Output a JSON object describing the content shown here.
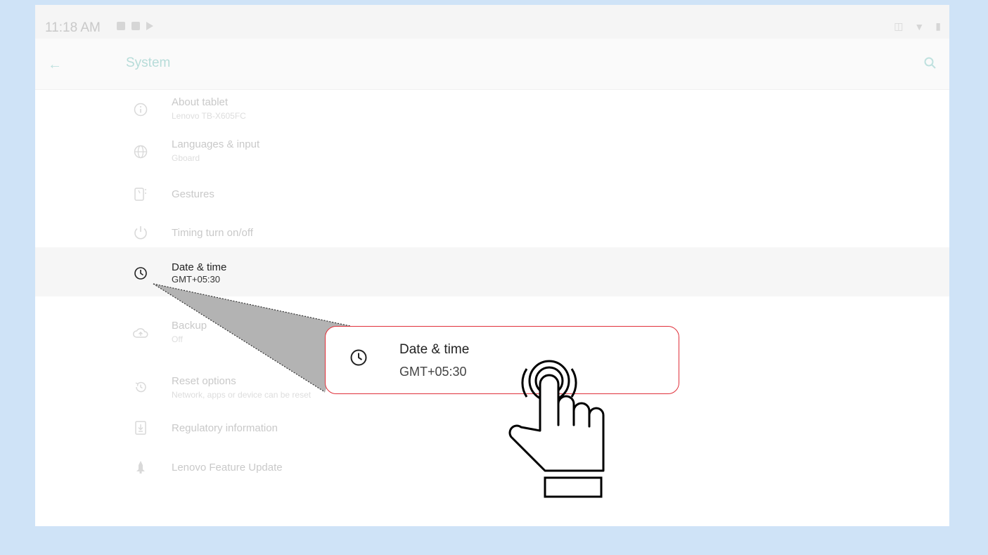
{
  "status_bar": {
    "time": "11:18 AM",
    "left_icons": [
      "image-icon",
      "sd-card-icon",
      "play-store-icon"
    ],
    "right_icons": [
      "vibrate-icon",
      "wifi-icon",
      "battery-icon"
    ]
  },
  "toolbar": {
    "back_icon": "arrow-left-icon",
    "title": "System",
    "search_icon": "search-icon"
  },
  "settings": [
    {
      "icon": "info-icon",
      "title": "About tablet",
      "subtitle": "Lenovo TB-X605FC"
    },
    {
      "icon": "globe-icon",
      "title": "Languages & input",
      "subtitle": "Gboard"
    },
    {
      "icon": "gestures-icon",
      "title": "Gestures",
      "subtitle": ""
    },
    {
      "icon": "power-icon",
      "title": "Timing turn on/off",
      "subtitle": ""
    },
    {
      "icon": "clock-icon",
      "title": "Date & time",
      "subtitle": "GMT+05:30"
    },
    {
      "icon": "backup-icon",
      "title": "Backup",
      "subtitle": "Off"
    },
    {
      "icon": "reset-icon",
      "title": "Reset options",
      "subtitle": "Network, apps or device can be reset"
    },
    {
      "icon": "regulatory-icon",
      "title": "Regulatory information",
      "subtitle": ""
    },
    {
      "icon": "update-icon",
      "title": "Lenovo Feature Update",
      "subtitle": ""
    }
  ],
  "callout": {
    "title": "Date & time",
    "subtitle": "GMT+05:30",
    "border_color": "#e0303a"
  },
  "colors": {
    "page_background": "#cfe3f7",
    "accent_teal": "#b7dcd9",
    "highlight_row": "#f6f6f6"
  }
}
